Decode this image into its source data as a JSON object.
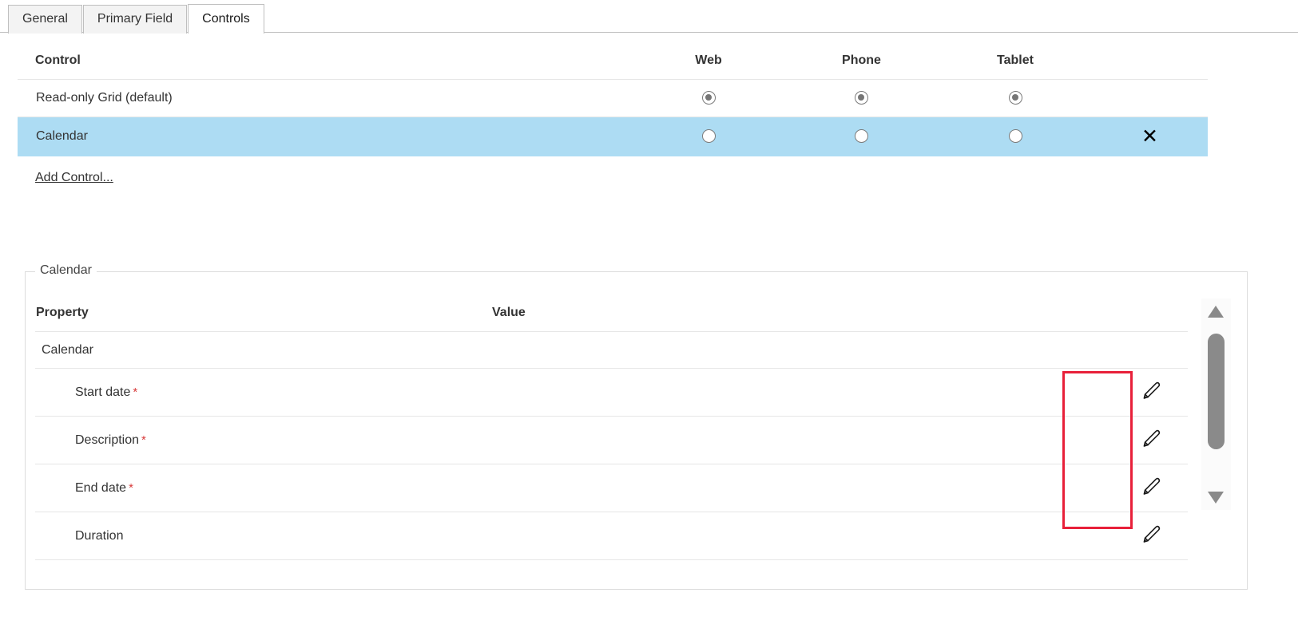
{
  "tabs": [
    {
      "label": "General",
      "active": false
    },
    {
      "label": "Primary Field",
      "active": false
    },
    {
      "label": "Controls",
      "active": true
    }
  ],
  "controls_table": {
    "headers": {
      "control": "Control",
      "web": "Web",
      "phone": "Phone",
      "tablet": "Tablet"
    },
    "rows": [
      {
        "name": "Read-only Grid (default)",
        "web": "selected",
        "phone": "selected",
        "tablet": "selected",
        "selected_row": false,
        "delete_icon": ""
      },
      {
        "name": "Calendar",
        "web": "unselected",
        "phone": "unselected",
        "tablet": "unselected",
        "selected_row": true,
        "delete_icon": "✕"
      }
    ],
    "add_control_label": "Add Control..."
  },
  "properties_panel": {
    "legend": "Calendar",
    "headers": {
      "property": "Property",
      "value": "Value"
    },
    "rows": [
      {
        "name": "Calendar",
        "required": "",
        "value": "",
        "indent": false,
        "edit_icon": ""
      },
      {
        "name": "Start date",
        "required": "*",
        "value": "",
        "indent": true,
        "edit_icon": "pencil-icon"
      },
      {
        "name": "Description",
        "required": "*",
        "value": "",
        "indent": true,
        "edit_icon": "pencil-icon"
      },
      {
        "name": "End date",
        "required": "*",
        "value": "",
        "indent": true,
        "edit_icon": "pencil-icon"
      },
      {
        "name": "Duration",
        "required": "",
        "value": "",
        "indent": true,
        "edit_icon": "pencil-icon"
      }
    ]
  },
  "scrollbar": {
    "up_arrow": "scroll-up-arrow",
    "down_arrow": "scroll-down-arrow",
    "thumb": "scroll-thumb"
  },
  "annotation": {
    "highlight_color": "#e8203a",
    "label": "edit-column-highlight"
  },
  "colors": {
    "selected_row": "#addcf3",
    "required_star": "#d83b3b",
    "border": "#e6e6e6",
    "tab_inactive": "#f3f3f3"
  }
}
